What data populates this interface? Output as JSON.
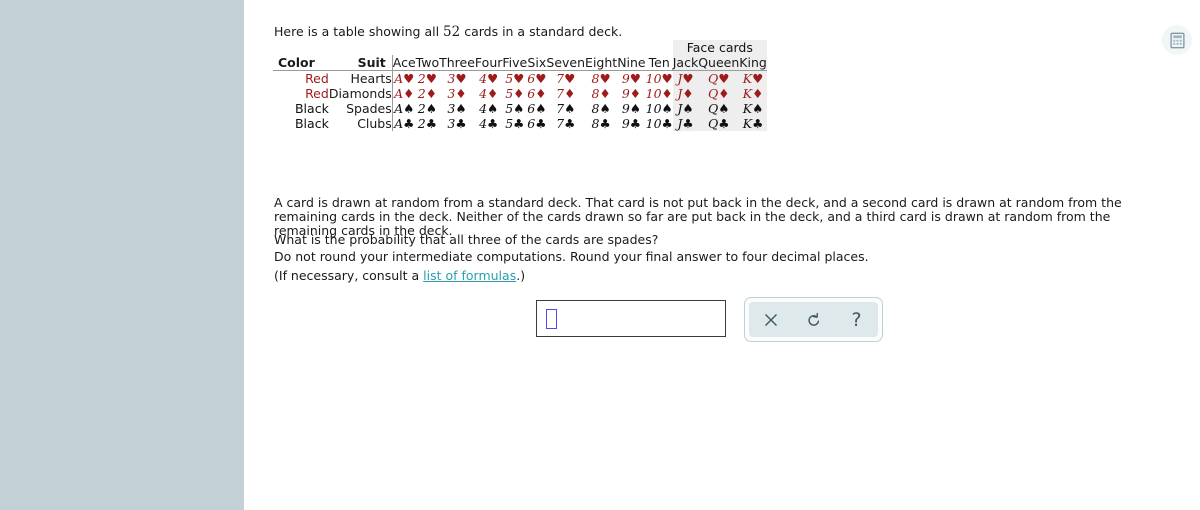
{
  "intro": {
    "before_number": "Here is a table showing all ",
    "number": "52",
    "after_number": " cards in a standard deck."
  },
  "table": {
    "group_headers": {
      "blank": "",
      "face_cards": "Face cards"
    },
    "headers": [
      "Color",
      "Suit",
      "Ace",
      "Two",
      "Three",
      "Four",
      "Five",
      "Six",
      "Seven",
      "Eight",
      "Nine",
      "Ten",
      "Jack",
      "Queen",
      "King"
    ],
    "face_card_columns": [
      "Jack",
      "Queen",
      "King"
    ],
    "rows": [
      {
        "color": "Red",
        "suit": "Hearts",
        "symbol": "♥",
        "color_class": "red",
        "cards": [
          "A♥",
          "2♥",
          "3♥",
          "4♥",
          "5♥",
          "6♥",
          "7♥",
          "8♥",
          "9♥",
          "10♥",
          "J♥",
          "Q♥",
          "K♥"
        ],
        "ranks": [
          "A",
          "2",
          "3",
          "4",
          "5",
          "6",
          "7",
          "8",
          "9",
          "10",
          "J",
          "Q",
          "K"
        ]
      },
      {
        "color": "Red",
        "suit": "Diamonds",
        "symbol": "♦",
        "color_class": "red",
        "cards": [
          "A♦",
          "2♦",
          "3♦",
          "4♦",
          "5♦",
          "6♦",
          "7♦",
          "8♦",
          "9♦",
          "10♦",
          "J♦",
          "Q♦",
          "K♦"
        ],
        "ranks": [
          "A",
          "2",
          "3",
          "4",
          "5",
          "6",
          "7",
          "8",
          "9",
          "10",
          "J",
          "Q",
          "K"
        ]
      },
      {
        "color": "Black",
        "suit": "Spades",
        "symbol": "♠",
        "color_class": "black",
        "cards": [
          "A♠",
          "2♠",
          "3♠",
          "4♠",
          "5♠",
          "6♠",
          "7♠",
          "8♠",
          "9♠",
          "10♠",
          "J♠",
          "Q♠",
          "K♠"
        ],
        "ranks": [
          "A",
          "2",
          "3",
          "4",
          "5",
          "6",
          "7",
          "8",
          "9",
          "10",
          "J",
          "Q",
          "K"
        ]
      },
      {
        "color": "Black",
        "suit": "Clubs",
        "symbol": "♣",
        "color_class": "black",
        "cards": [
          "A♣",
          "2♣",
          "3♣",
          "4♣",
          "5♣",
          "6♣",
          "7♣",
          "8♣",
          "9♣",
          "10♣",
          "J♣",
          "Q♣",
          "K♣"
        ],
        "ranks": [
          "A",
          "2",
          "3",
          "4",
          "5",
          "6",
          "7",
          "8",
          "9",
          "10",
          "J",
          "Q",
          "K"
        ]
      }
    ]
  },
  "problem": {
    "setup": "A card is drawn at random from a standard deck. That card is not put back in the deck, and a second card is drawn at random from the remaining cards in the deck. Neither of the cards drawn so far are put back in the deck, and a third card is drawn at random from the remaining cards in the deck.",
    "question": "What is the probability that all three of the cards are spades?",
    "rounding": "Do not round your intermediate computations. Round your final answer to four decimal places.",
    "formulas_prefix": "(If necessary, consult a ",
    "formulas_link": "list of formulas",
    "formulas_suffix": ".)"
  },
  "answer": {
    "value": "",
    "placeholder": ""
  },
  "toolbar": {
    "clear_label": "×",
    "undo_label": "↺",
    "help_label": "?",
    "clear_name": "clear",
    "undo_name": "undo",
    "help_name": "help"
  },
  "calculator": {
    "label": "calculator"
  },
  "colors": {
    "sidebar": "#c3d0d6",
    "red_suit": "#9e1b1b",
    "black_suit": "#111111",
    "link": "#2a9fae",
    "face_shade": "#eeeeee",
    "cursor_box": "#4b4bf5"
  }
}
